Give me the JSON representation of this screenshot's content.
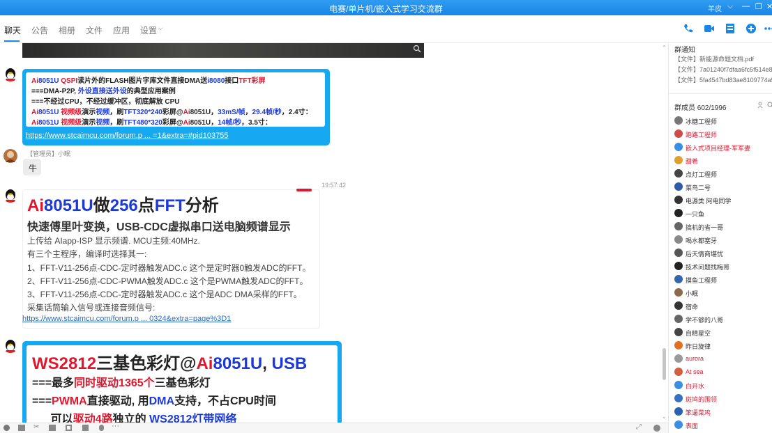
{
  "window": {
    "title": "电赛/单片机/嵌入式学习交流群",
    "user": "羊皮"
  },
  "tabs": [
    "聊天",
    "公告",
    "相册",
    "文件",
    "应用",
    "设置"
  ],
  "messages": {
    "msg1": {
      "lines": [
        [
          [
            "r",
            "Ai"
          ],
          [
            "b",
            "8051U "
          ],
          [
            "r",
            "QSPI"
          ],
          [
            "",
            "读片外的FLASH图片字库文件直接DMA送"
          ],
          [
            "b",
            "i8080"
          ],
          [
            "",
            "接口"
          ],
          [
            "r",
            "TFT彩屏"
          ]
        ],
        [
          [
            "",
            "===DMA-P2P, "
          ],
          [
            "b",
            "外设直接送外设"
          ],
          [
            "",
            "的典型应用案例"
          ]
        ],
        [
          [
            "",
            "===不经过CPU，不经过缓冲区，彻底解放 CPU"
          ]
        ],
        [
          [
            "r",
            "Ai"
          ],
          [
            "b",
            "8051U "
          ],
          [
            "r",
            "视频级"
          ],
          [
            "",
            "演示"
          ],
          [
            "b",
            "视频"
          ],
          [
            "",
            "，刷"
          ],
          [
            "b",
            "TFT320*240"
          ],
          [
            "",
            "彩屏@"
          ],
          [
            "r",
            "Ai"
          ],
          [
            "",
            "8051U，"
          ],
          [
            "b",
            "33mS/帧"
          ],
          [
            "",
            "，"
          ],
          [
            "b",
            "29.4帧/秒"
          ],
          [
            "",
            "，2.4寸："
          ]
        ],
        [
          [
            "r",
            "Ai"
          ],
          [
            "b",
            "8051U "
          ],
          [
            "r",
            "视频级"
          ],
          [
            "",
            "演示"
          ],
          [
            "b",
            "视频"
          ],
          [
            "",
            "，刷"
          ],
          [
            "b",
            "TFT480*320"
          ],
          [
            "",
            "彩屏@"
          ],
          [
            "r",
            "Ai"
          ],
          [
            "",
            "8051U，"
          ],
          [
            "b",
            "14帧/秒"
          ],
          [
            "",
            "，3.5寸："
          ]
        ]
      ],
      "link": "https://www.stcaimcu.com/forum.p ... =1&extra=#pid103755"
    },
    "msg2": {
      "sender": "【管理员】小眠",
      "text": "牛"
    },
    "msg3": {
      "time": "19:57:42",
      "title": [
        [
          "r",
          "Ai"
        ],
        [
          "b",
          "8051U"
        ],
        [
          "",
          "做"
        ],
        [
          "b",
          "256"
        ],
        [
          "",
          "点"
        ],
        [
          "b",
          "FFT"
        ],
        [
          "",
          "分析"
        ]
      ],
      "subtitle": "快速傅里叶变换，USB-CDC虚拟串口送电脑频谱显示",
      "body": [
        "上传给 AIapp-ISP 显示频谱. MCU主频:40MHz.",
        "有三个主程序，编译时选择其一:",
        "1、FFT-V11-256点-CDC-定时器触发ADC.c    这个是定时器0触发ADC的FFT。",
        "2、FFT-V11-256点-CDC-PWMA触发ADC.c    这个是PWMA触发ADC的FFT。",
        "3、FFT-V11-256点-CDC-定时器触发ADC.c  这个是ADC DMA采样的FFT。",
        "采集话筒输入信号或连接音频信号:"
      ],
      "link": "https://www.stcaimcu.com/forum.p ... 0324&extra=page%3D1"
    },
    "msg4": {
      "lines": [
        [
          [
            "r",
            "WS2812"
          ],
          [
            "",
            "三基色彩灯@"
          ],
          [
            "r",
            "Ai"
          ],
          [
            "b",
            "8051U"
          ],
          [
            "",
            ", "
          ],
          [
            "b",
            "USB"
          ]
        ],
        [
          [
            "",
            "===最多"
          ],
          [
            "r",
            "同时驱动1365个"
          ],
          [
            "",
            "三基色彩灯"
          ]
        ],
        [
          [
            "",
            "==="
          ],
          [
            "r",
            "PWMA"
          ],
          [
            "",
            "直接驱动, 用"
          ],
          [
            "b",
            "DMA"
          ],
          [
            "",
            "支持，不占CPU时间"
          ]
        ],
        [
          [
            "",
            "      可以"
          ],
          [
            "r",
            "驱动4路"
          ],
          [
            "",
            "独立的 "
          ],
          [
            "b",
            "WS2812灯带网络"
          ]
        ]
      ]
    }
  },
  "sidebar": {
    "notice_title": "群通知",
    "files": [
      "【文件】新能源命题文档.pdf",
      "【文件】7a01240f7dfaa6fc5f514e8b5...",
      "【文件】5fa4547bd83ae8109774a58d..."
    ],
    "members_title": "群成员 602/1996",
    "members": [
      {
        "name": "冰糖工程师",
        "red": false,
        "color": "#777777"
      },
      {
        "name": "跑路工程师",
        "red": true,
        "color": "#d04a4a"
      },
      {
        "name": "嵌入式项目经理-军军妻",
        "red": true,
        "color": "#3a8ee6"
      },
      {
        "name": "甜希",
        "red": true,
        "color": "#e0a030"
      },
      {
        "name": "点灯工程师",
        "red": false,
        "color": "#444444"
      },
      {
        "name": "菜鸟二号",
        "red": false,
        "color": "#2e5aa8"
      },
      {
        "name": "电源类 阿电同学",
        "red": false,
        "color": "#333333"
      },
      {
        "name": "一只鱼",
        "red": false,
        "color": "#222222"
      },
      {
        "name": "搞机的省一哥",
        "red": false,
        "color": "#666666"
      },
      {
        "name": "喝水都塞牙",
        "red": false,
        "color": "#888888"
      },
      {
        "name": "后天情商堪忧",
        "red": false,
        "color": "#555555"
      },
      {
        "name": "技术问题找梅哥",
        "red": false,
        "color": "#222222"
      },
      {
        "name": "摸鱼工程师",
        "red": false,
        "color": "#3366aa"
      },
      {
        "name": "小眠",
        "red": false,
        "color": "#8a6a4a"
      },
      {
        "name": "宿命",
        "red": false,
        "color": "#333333"
      },
      {
        "name": "学不够的八哥",
        "red": false,
        "color": "#666666"
      },
      {
        "name": "自精星空",
        "red": false,
        "color": "#444444"
      },
      {
        "name": "昨日旋律",
        "red": false,
        "color": "#e07020"
      },
      {
        "name": "aurora",
        "red": true,
        "color": "#999999"
      },
      {
        "name": "At sea",
        "red": true,
        "color": "#d06040"
      },
      {
        "name": "白开水",
        "red": true,
        "color": "#3a8ee6"
      },
      {
        "name": "斑鸠的围领",
        "red": true,
        "color": "#3a70c0"
      },
      {
        "name": "笨逼菜鸡",
        "red": true,
        "color": "#2a60b0"
      },
      {
        "name": "表面",
        "red": true,
        "color": "#3a8ee6"
      }
    ]
  }
}
